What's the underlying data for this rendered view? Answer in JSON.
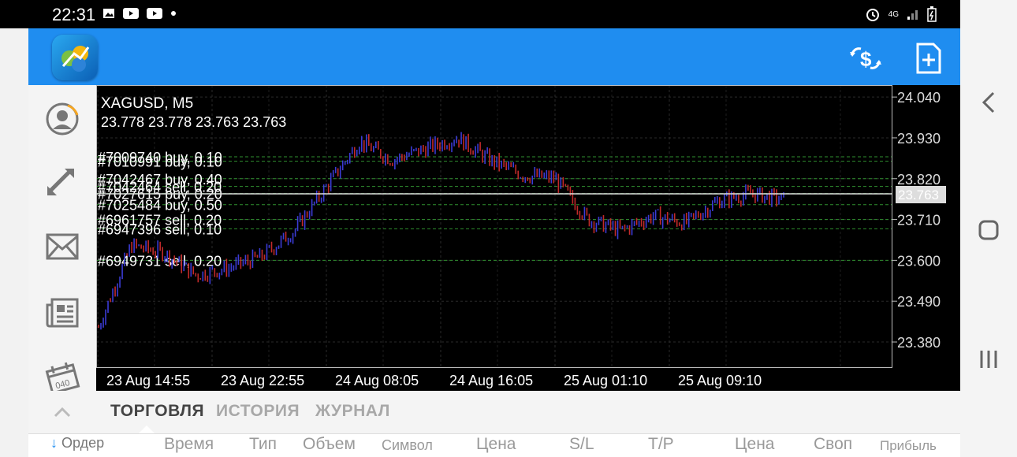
{
  "status": {
    "time": "22:31",
    "network": "4G"
  },
  "chart": {
    "symbol_line": "XAGUSD, M5",
    "ohlc_line": "23.778 23.778 23.763 23.763",
    "current_price": "23.763",
    "y_ticks": [
      "24.040",
      "23.930",
      "23.820",
      "23.710",
      "23.600",
      "23.490",
      "23.380"
    ],
    "x_ticks": [
      "23 Aug 14:55",
      "23 Aug 22:55",
      "24 Aug 08:05",
      "24 Aug 16:05",
      "25 Aug 01:10",
      "25 Aug 09:10"
    ],
    "orders": [
      {
        "text": "#7009740 buy, 0.10",
        "price": 23.879
      },
      {
        "text": "#7010991 buy, 0.10",
        "price": 23.867
      },
      {
        "text": "#7042467 buy, 0.40",
        "price": 23.82
      },
      {
        "text": "#7042464 sell, 0.20",
        "price": 23.799
      },
      {
        "text": "#7027615 buy, 0.20",
        "price": 23.78
      },
      {
        "text": "#7025484 buy, 0.50",
        "price": 23.75
      },
      {
        "text": "#6961757 sell, 0.20",
        "price": 23.71
      },
      {
        "text": "#6947396 sell, 0.10",
        "price": 23.685
      },
      {
        "text": "#6949731 sell, 0.20",
        "price": 23.6
      }
    ],
    "colors": {
      "bull": "#3b3bd6",
      "bear": "#c22a2a",
      "order_line": "#2f8f2f"
    }
  },
  "tabs": [
    "ТОРГОВЛЯ",
    "ИСТОРИЯ",
    "ЖУРНАЛ"
  ],
  "columns": [
    "Ордер",
    "Время",
    "Тип",
    "Объем",
    "Символ",
    "Цена",
    "S/L",
    "T/P",
    "Цена",
    "Своп",
    "Прибыль"
  ],
  "chart_data": {
    "type": "candlestick",
    "title": "XAGUSD, M5",
    "ylim": [
      23.31,
      24.07
    ],
    "x": [
      "23 Aug 14:55",
      "23 Aug 22:55",
      "24 Aug 08:05",
      "24 Aug 16:05",
      "25 Aug 01:10",
      "25 Aug 09:10"
    ],
    "close": [
      23.42,
      23.64,
      23.62,
      23.56,
      23.58,
      23.61,
      23.68,
      23.8,
      23.92,
      23.87,
      23.9,
      23.93,
      23.87,
      23.83,
      23.82,
      23.71,
      23.68,
      23.72,
      23.7,
      23.76,
      23.78,
      23.763
    ]
  }
}
